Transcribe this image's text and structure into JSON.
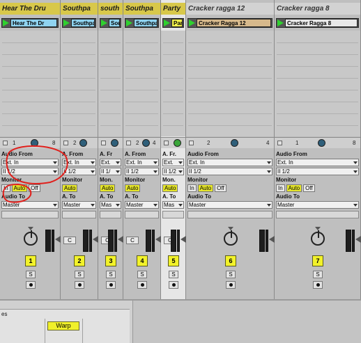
{
  "tracks": [
    {
      "title": "Hear The Dru",
      "clip": "Hear The Dr",
      "clip_color": "#8fd3f0",
      "title_style": "midi",
      "io_nums": [
        "1",
        "8"
      ],
      "label_from": "Audio From",
      "from": "Ext. In",
      "ch": "II 1/2",
      "monitor_label": "Monitor",
      "monitor": [
        "In",
        "Auto",
        "Off"
      ],
      "label_to": "Audio To",
      "to": "Master",
      "c": "",
      "num": "1"
    },
    {
      "title": "Southpa",
      "clip": "Southpa",
      "clip_color": "#8fd3f0",
      "title_style": "midi",
      "io_nums": [
        "2"
      ],
      "label_from": "A. From",
      "from": "Ext. In",
      "ch": "II 1/2",
      "monitor_label": "Monitor",
      "monitor": [
        "Auto"
      ],
      "label_to": "A. To",
      "to": "Master",
      "c": "C",
      "num": "2"
    },
    {
      "title": "south",
      "clip": "Sou",
      "clip_color": "#8fd3f0",
      "title_style": "midi",
      "io_nums": [],
      "label_from": "A. Fr",
      "from": "Ext.",
      "ch": "II 1/",
      "monitor_label": "Mon.",
      "monitor": [
        "Auto"
      ],
      "label_to": "A. To",
      "to": "Mas",
      "c": "C",
      "num": "3"
    },
    {
      "title": "Southpa",
      "clip": "Southpa",
      "clip_color": "#8fd3f0",
      "title_style": "midi",
      "io_nums": [
        "2",
        "4"
      ],
      "label_from": "A. From",
      "from": "Ext. In",
      "ch": "II 1/2",
      "monitor_label": "Monitor",
      "monitor": [
        "Auto"
      ],
      "label_to": "A. To",
      "to": "Master",
      "c": "C",
      "num": "4"
    },
    {
      "title": "Party",
      "clip": "Par",
      "clip_color": "#f0f04a",
      "title_style": "midi",
      "io_nums": [],
      "label_from": "A. Fr.",
      "from": "Ext.",
      "ch": "II 1/2",
      "monitor_label": "Mon.",
      "monitor": [
        "Auto"
      ],
      "label_to": "A. To",
      "to": "Mas",
      "c": "C",
      "num": "5"
    },
    {
      "title": "Cracker ragga 12",
      "clip": "Cracker Ragga 12",
      "clip_color": "#d7b98c",
      "title_style": "audio",
      "io_nums": [
        "2",
        "4"
      ],
      "label_from": "Audio From",
      "from": "Ext. In",
      "ch": "II 1/2",
      "monitor_label": "Monitor",
      "monitor": [
        "In",
        "Auto",
        "Off"
      ],
      "label_to": "Audio To",
      "to": "Master",
      "c": "",
      "num": "6"
    },
    {
      "title": "Cracker ragga 8",
      "clip": "Cracker Ragga 8",
      "clip_color": "#e8e8e8",
      "title_style": "audio",
      "io_nums": [
        "1",
        "8"
      ],
      "label_from": "Audio From",
      "from": "Ext. In",
      "ch": "II 1/2",
      "monitor_label": "Monitor",
      "monitor": [
        "In",
        "Auto",
        "Off"
      ],
      "label_to": "Audio To",
      "to": "Master",
      "c": "",
      "num": "7"
    }
  ],
  "solo_label": "S",
  "bottom": {
    "left_label": "es",
    "warp": "Warp"
  },
  "colors": {
    "accent_yellow": "#f2f22a",
    "play_green": "#2ed12e",
    "annotation_red": "#e0201c"
  }
}
